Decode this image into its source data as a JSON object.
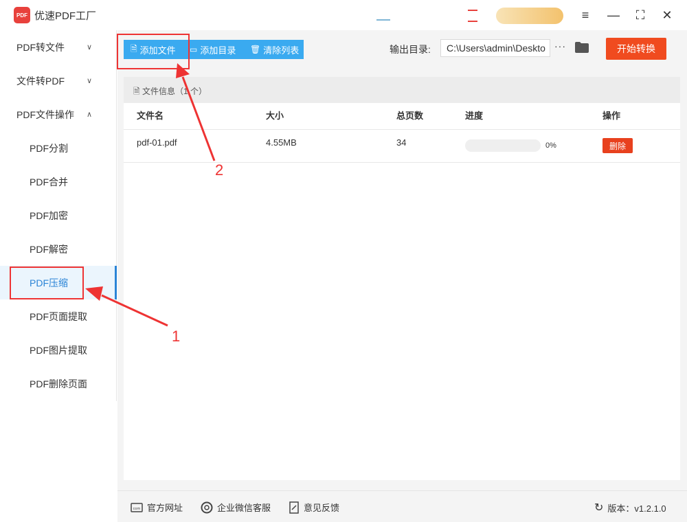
{
  "app": {
    "title": "优速PDF工厂",
    "logo_text": "PDF"
  },
  "sidebar": {
    "groups": [
      {
        "label": "PDF转文件"
      },
      {
        "label": "文件转PDF"
      },
      {
        "label": "PDF文件操作"
      }
    ],
    "items": [
      {
        "label": "PDF分割"
      },
      {
        "label": "PDF合并"
      },
      {
        "label": "PDF加密"
      },
      {
        "label": "PDF解密"
      },
      {
        "label": "PDF压缩",
        "active": true
      },
      {
        "label": "PDF页面提取"
      },
      {
        "label": "PDF图片提取"
      },
      {
        "label": "PDF删除页面"
      }
    ]
  },
  "toolbar": {
    "add_file": "添加文件",
    "add_folder": "添加目录",
    "clear_list": "清除列表",
    "output_label": "输出目录:",
    "output_path": "C:\\Users\\admin\\Deskto",
    "more": "···",
    "start": "开始转换"
  },
  "panel": {
    "file_info": "文件信息（1 个）",
    "columns": {
      "name": "文件名",
      "size": "大小",
      "pages": "总页数",
      "progress": "进度",
      "action": "操作"
    },
    "rows": [
      {
        "name": "pdf-01.pdf",
        "size": "4.55MB",
        "pages": "34",
        "progress_label": "0%",
        "progress_value": 0,
        "action": "删除"
      }
    ]
  },
  "footer": {
    "website": "官方网址",
    "wechat": "企业微信客服",
    "feedback": "意见反馈",
    "version": "版本：v1.2.1.0"
  },
  "annotations": {
    "label_1": "1",
    "label_2": "2"
  },
  "colors": {
    "accent": "#3aaaf0",
    "start": "#f04b1f",
    "delete": "#e8411e",
    "annotation": "#e33333"
  }
}
